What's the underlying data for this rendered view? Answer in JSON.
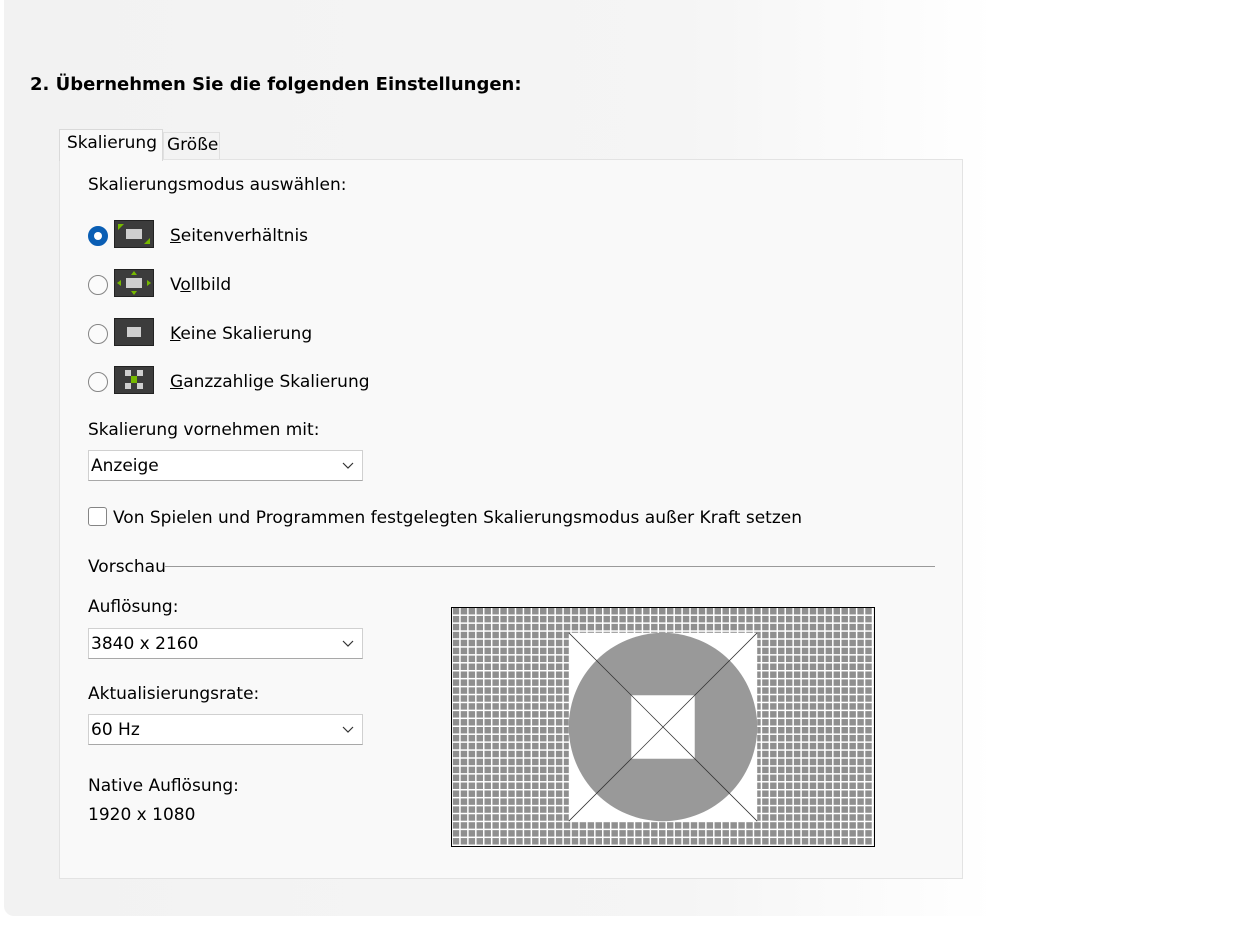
{
  "section": {
    "title": "2. Übernehmen Sie die folgenden Einstellungen:"
  },
  "tabs": [
    {
      "label": "Skalierung",
      "active": true
    },
    {
      "label": "Größe",
      "active": false
    }
  ],
  "scaling": {
    "mode_label": "Skalierungsmodus auswählen:",
    "modes": [
      {
        "accel": "S",
        "rest": "eitenverhältnis",
        "icon": "aspect-ratio-icon",
        "selected": true
      },
      {
        "pre": "V",
        "accel": "o",
        "rest": "llbild",
        "icon": "fullscreen-icon",
        "selected": false
      },
      {
        "accel": "K",
        "rest": "eine Skalierung",
        "icon": "no-scaling-icon",
        "selected": false
      },
      {
        "accel": "G",
        "rest": "anzzahlige Skalierung",
        "icon": "integer-scaling-icon",
        "selected": false
      }
    ],
    "perform_label": "Skalierung vornehmen mit:",
    "perform_value": "Anzeige",
    "override_label": "Von Spielen und Programmen festgelegten Skalierungsmodus außer Kraft setzen",
    "override_checked": false
  },
  "preview": {
    "group_label": "Vorschau",
    "resolution_label": "Auflösung:",
    "resolution_value": "3840 x 2160",
    "refresh_label": "Aktualisierungsrate:",
    "refresh_value": "60 Hz",
    "native_label": "Native Auflösung:",
    "native_value": "1920 x 1080"
  },
  "colors": {
    "accent": "#0a5eb4",
    "icon_green": "#76b900"
  }
}
